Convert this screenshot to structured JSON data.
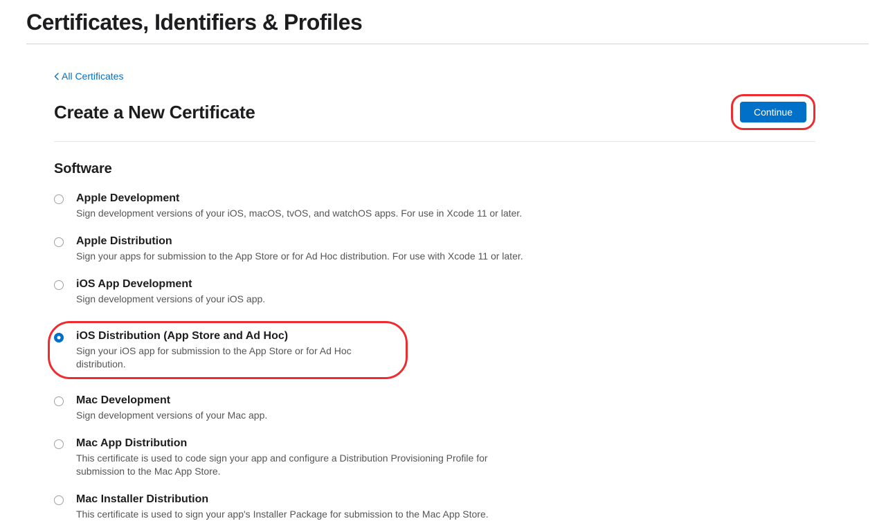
{
  "header": {
    "title": "Certificates, Identifiers & Profiles"
  },
  "back": {
    "label": "All Certificates"
  },
  "sub": {
    "title": "Create a New Certificate",
    "continue_label": "Continue"
  },
  "section": {
    "title": "Software"
  },
  "options": [
    {
      "title": "Apple Development",
      "desc": "Sign development versions of your iOS, macOS, tvOS, and watchOS apps. For use in Xcode 11 or later.",
      "selected": false,
      "highlighted": false
    },
    {
      "title": "Apple Distribution",
      "desc": "Sign your apps for submission to the App Store or for Ad Hoc distribution. For use with Xcode 11 or later.",
      "selected": false,
      "highlighted": false
    },
    {
      "title": "iOS App Development",
      "desc": "Sign development versions of your iOS app.",
      "selected": false,
      "highlighted": false
    },
    {
      "title": "iOS Distribution (App Store and Ad Hoc)",
      "desc": "Sign your iOS app for submission to the App Store or for Ad Hoc distribution.",
      "selected": true,
      "highlighted": true
    },
    {
      "title": "Mac Development",
      "desc": "Sign development versions of your Mac app.",
      "selected": false,
      "highlighted": false
    },
    {
      "title": "Mac App Distribution",
      "desc": "This certificate is used to code sign your app and configure a Distribution Provisioning Profile for submission to the Mac App Store.",
      "selected": false,
      "highlighted": false
    },
    {
      "title": "Mac Installer Distribution",
      "desc": "This certificate is used to sign your app's Installer Package for submission to the Mac App Store.",
      "selected": false,
      "highlighted": false
    }
  ]
}
